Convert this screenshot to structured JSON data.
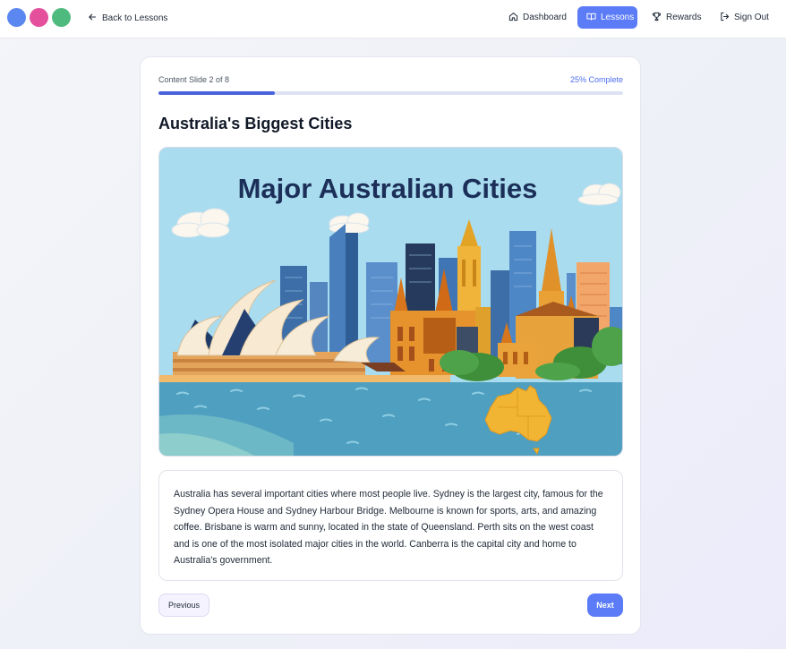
{
  "logo": {
    "dot_colors": [
      "#5b87f0",
      "#e5509c",
      "#4fba7d"
    ]
  },
  "header": {
    "back_label": "Back to Lessons",
    "nav": [
      {
        "label": "Dashboard",
        "icon": "home-icon",
        "active": false
      },
      {
        "label": "Lessons",
        "icon": "book-icon",
        "active": true
      },
      {
        "label": "Rewards",
        "icon": "trophy-icon",
        "active": false
      },
      {
        "label": "Sign Out",
        "icon": "sign-out-icon",
        "active": false
      }
    ]
  },
  "lesson": {
    "slide_label": "Content Slide 2 of 8",
    "percent_label": "25% Complete",
    "progress_fraction": 0.25,
    "title": "Australia's Biggest Cities",
    "image_title": "Major Australian Cities",
    "body": "Australia has several important cities where most people live. Sydney is the largest city, famous for the Sydney Opera House and Sydney Harbour Bridge. Melbourne is known for sports, arts, and amazing coffee. Brisbane is warm and sunny, located in the state of Queensland. Perth sits on the west coast and is one of the most isolated major cities in the world. Canberra is the capital city and home to Australia's government."
  },
  "buttons": {
    "previous": "Previous",
    "next": "Next"
  },
  "colors": {
    "accent": "#5b7cf6",
    "progress": "#4a63dc",
    "sky": "#a9dcef",
    "water": "#4f9fc0",
    "map": "#f2b533"
  }
}
